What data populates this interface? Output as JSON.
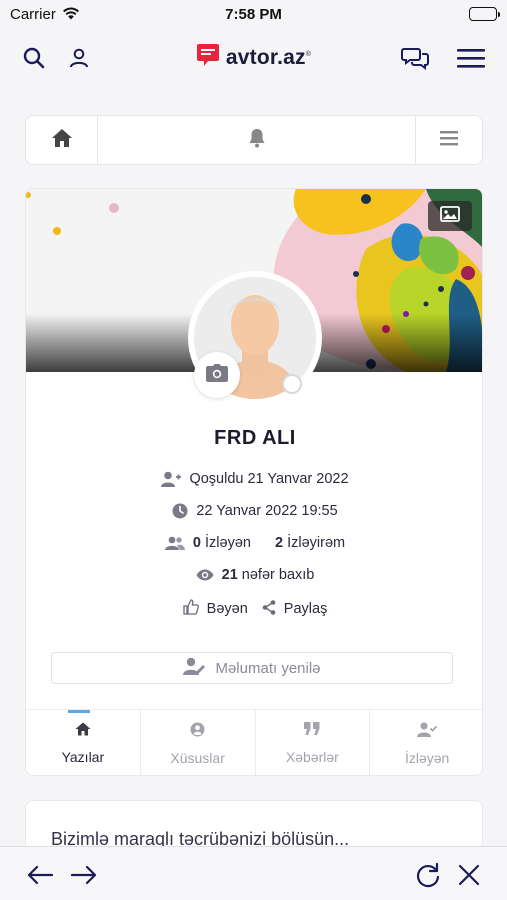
{
  "status_bar": {
    "carrier": "Carrier",
    "time": "7:58 PM"
  },
  "header": {
    "logo_text": "avtor.az",
    "logo_mark": "®"
  },
  "profile": {
    "name": "FRD ALI",
    "joined": "Qoşuldu 21 Yanvar 2022",
    "last_seen": "22 Yanvar 2022 19:55",
    "followers_count": "0",
    "followers_label": "İzləyən",
    "following_count": "2",
    "following_label": "İzləyirəm",
    "views_count": "21",
    "views_label": "nəfər baxıb",
    "like_label": "Bəyən",
    "share_label": "Paylaş",
    "update_label": "Məlumatı yenilə"
  },
  "profile_tabs": [
    {
      "label": "Yazılar",
      "icon": "home-icon"
    },
    {
      "label": "Xüsuslar",
      "icon": "user-circle-icon"
    },
    {
      "label": "Xəbərlər",
      "icon": "quote-icon"
    },
    {
      "label": "İzləyən",
      "icon": "user-check-icon"
    }
  ],
  "post_prompt": "Bizimlə maraqlı təcrübənizi bölüsün...",
  "colors": {
    "accent": "#5aa9e6",
    "brand": "#e8243c",
    "text_dark": "#1c1c2e"
  }
}
